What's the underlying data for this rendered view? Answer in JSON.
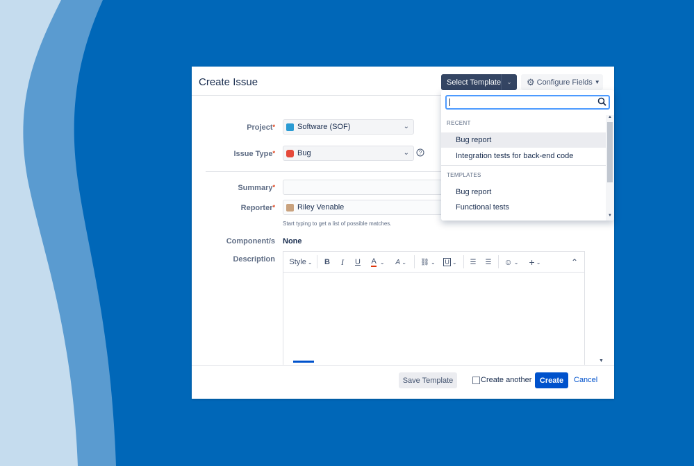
{
  "dialog": {
    "title": "Create Issue",
    "select_template_label": "Select Template",
    "configure_fields_label": "Configure Fields"
  },
  "form": {
    "project_label": "Project",
    "project_value": "Software (SOF)",
    "issue_type_label": "Issue Type",
    "issue_type_value": "Bug",
    "summary_label": "Summary",
    "summary_value": "",
    "reporter_label": "Reporter",
    "reporter_value": "Riley Venable",
    "reporter_hint": "Start typing to get a list of possible matches.",
    "components_label": "Component/s",
    "components_value": "None",
    "description_label": "Description",
    "required_mark": "*"
  },
  "editor_toolbar": {
    "style_label": "Style",
    "bold": "B",
    "italic": "I",
    "underline": "U",
    "text_color": "A",
    "more_format": "A",
    "link": "🔗",
    "attachment": "U",
    "bullet_list": "☰",
    "numbered_list": "☰",
    "emoji": "☺",
    "insert": "+",
    "collapse": "⌃"
  },
  "footer": {
    "save_template_label": "Save Template",
    "create_another_label": "Create another",
    "create_label": "Create",
    "cancel_label": "Cancel"
  },
  "template_dropdown": {
    "search_value": "",
    "recent_heading": "RECENT",
    "recent_items": [
      "Bug report",
      "Integration tests for back-end code"
    ],
    "templates_heading": "TEMPLATES",
    "template_items": [
      "Bug report",
      "Functional tests"
    ]
  },
  "colors": {
    "background": "#0067b8",
    "wave_light": "#c5dcee",
    "wave_mid": "#5a9bd0",
    "primary_button": "#0052cc",
    "dark_button": "#344563",
    "focus_ring": "#4c9aff",
    "bug_icon": "#e5493a",
    "project_icon": "#2a9bd3"
  },
  "icons": [
    "gear-icon",
    "chevron-down-icon",
    "search-icon",
    "help-icon",
    "bug-icon",
    "project-icon",
    "avatar",
    "resize-grip-icon"
  ]
}
